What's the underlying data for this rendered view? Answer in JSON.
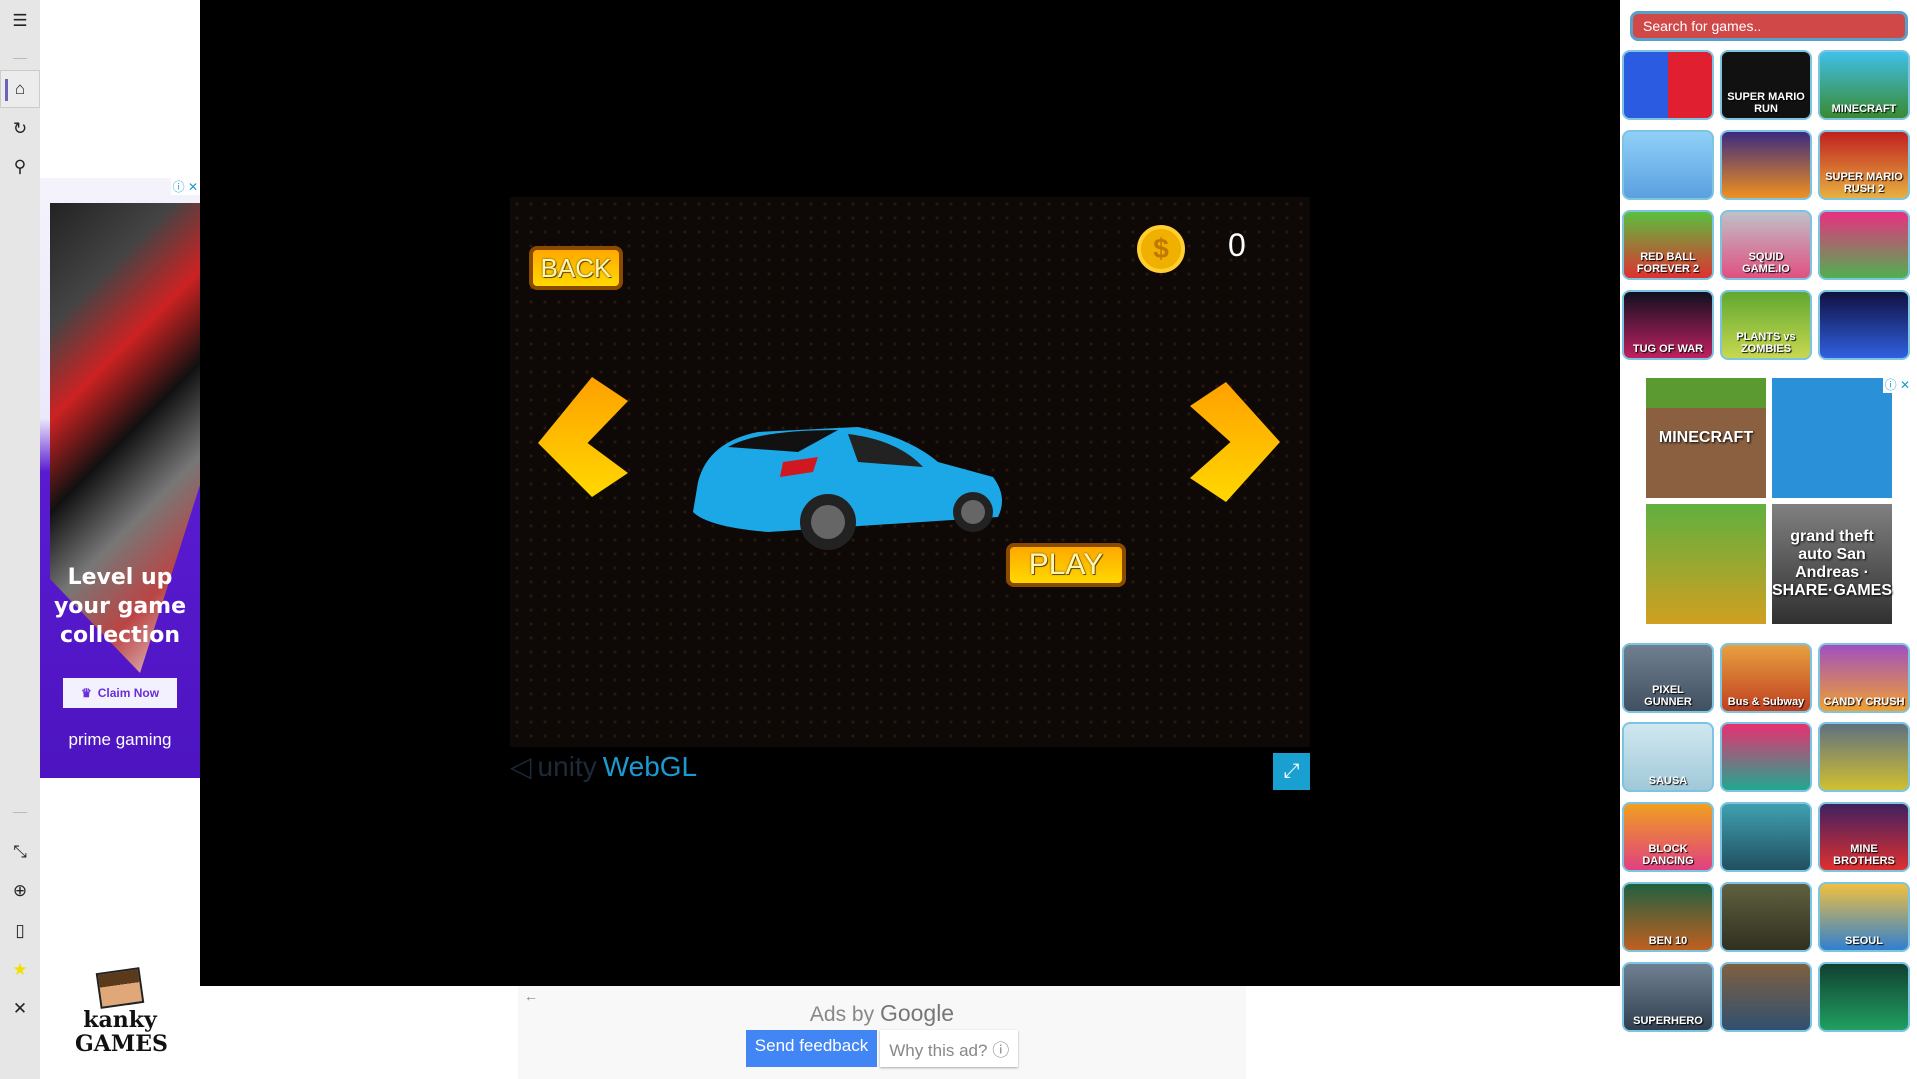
{
  "sidebar": {
    "icons": [
      "menu-icon",
      "home-icon",
      "refresh-icon",
      "search-icon",
      "minimize-icon",
      "globe-icon",
      "bag-icon",
      "star-icon",
      "close-icon"
    ]
  },
  "left_ad": {
    "headline": "Level up your game collection",
    "cta": "Claim Now",
    "brand": "prime gaming",
    "info": "ⓘ",
    "close": "✕"
  },
  "logo": {
    "line1": "kanky",
    "line2": "GAMES"
  },
  "game": {
    "back": "BACK",
    "play": "PLAY",
    "coins": "0",
    "coin_symbol": "$",
    "unity": "unity",
    "webgl": "WebGL",
    "fullscreen": "⤢"
  },
  "bottom_ad": {
    "ads_by": "Ads by",
    "google": "Google",
    "send_feedback": "Send feedback",
    "why": "Why this ad? ⓘ",
    "back": "←"
  },
  "right": {
    "search_placeholder": "Search for games..",
    "tiles": [
      {
        "label": "",
        "color": "linear-gradient(90deg,#2a5be0 50%,#e02030 50%)"
      },
      {
        "label": "SUPER MARIO RUN",
        "color": "#111"
      },
      {
        "label": "MINECRAFT",
        "color": "linear-gradient(#40c0e8,#3a8a30)"
      },
      {
        "label": "",
        "color": "linear-gradient(#90d0f8,#5aa0e0)"
      },
      {
        "label": "",
        "color": "linear-gradient(#3a2a80,#f09020)"
      },
      {
        "label": "SUPER MARIO RUSH 2",
        "color": "linear-gradient(#c02020,#e8b040)"
      },
      {
        "label": "RED BALL FOREVER 2",
        "color": "linear-gradient(#5ac040,#e03030)"
      },
      {
        "label": "SQUID GAME.IO",
        "color": "linear-gradient(#c0c0c8,#e05080)"
      },
      {
        "label": "",
        "color": "linear-gradient(#e83080,#50b050)"
      },
      {
        "label": "TUG OF WAR",
        "color": "linear-gradient(#101020,#c02060)"
      },
      {
        "label": "PLANTS vs ZOMBIES",
        "color": "linear-gradient(#60a830,#c8d850)"
      },
      {
        "label": "",
        "color": "linear-gradient(#101040,#3060e0)"
      },
      {
        "label": "PIXEL GUNNER",
        "color": "linear-gradient(#708090,#405060)"
      },
      {
        "label": "Bus & Subway",
        "color": "linear-gradient(#e8a040,#c04020)"
      },
      {
        "label": "CANDY CRUSH",
        "color": "linear-gradient(#a050c0,#f0a030)"
      },
      {
        "label": "SAUSA",
        "color": "linear-gradient(#d0e8f0,#a0c8d8)"
      },
      {
        "label": "",
        "color": "linear-gradient(#e83070,#20a890)"
      },
      {
        "label": "",
        "color": "linear-gradient(#607080,#d0c030)"
      },
      {
        "label": "BLOCK DANCING",
        "color": "linear-gradient(#f0a020,#e04080)"
      },
      {
        "label": "",
        "color": "linear-gradient(#40a0b0,#205060)"
      },
      {
        "label": "MINE BROTHERS",
        "color": "linear-gradient(#402060,#e03030)"
      },
      {
        "label": "BEN 10",
        "color": "linear-gradient(#206040,#c06020)"
      },
      {
        "label": "",
        "color": "linear-gradient(#606040,#303020)"
      },
      {
        "label": "SEOUL",
        "color": "linear-gradient(#f0c040,#3080d0)"
      },
      {
        "label": "SUPERHERO",
        "color": "linear-gradient(#708090,#304050)"
      },
      {
        "label": "",
        "color": "linear-gradient(#806040,#305070)"
      },
      {
        "label": "",
        "color": "linear-gradient(#104030,#20a060)"
      }
    ],
    "ad": {
      "info": "ⓘ",
      "close": "✕",
      "items": [
        {
          "label": "MINECRAFT",
          "color": "linear-gradient(#5a9a30 25%,#8a6040 25%)"
        },
        {
          "label": "",
          "color": "#2a90d8"
        },
        {
          "label": "",
          "color": "linear-gradient(#60b040,#d0a020)"
        },
        {
          "label": "grand theft auto San Andreas · SHARE·GAMES",
          "color": "linear-gradient(#808080,#303030)"
        }
      ]
    }
  }
}
